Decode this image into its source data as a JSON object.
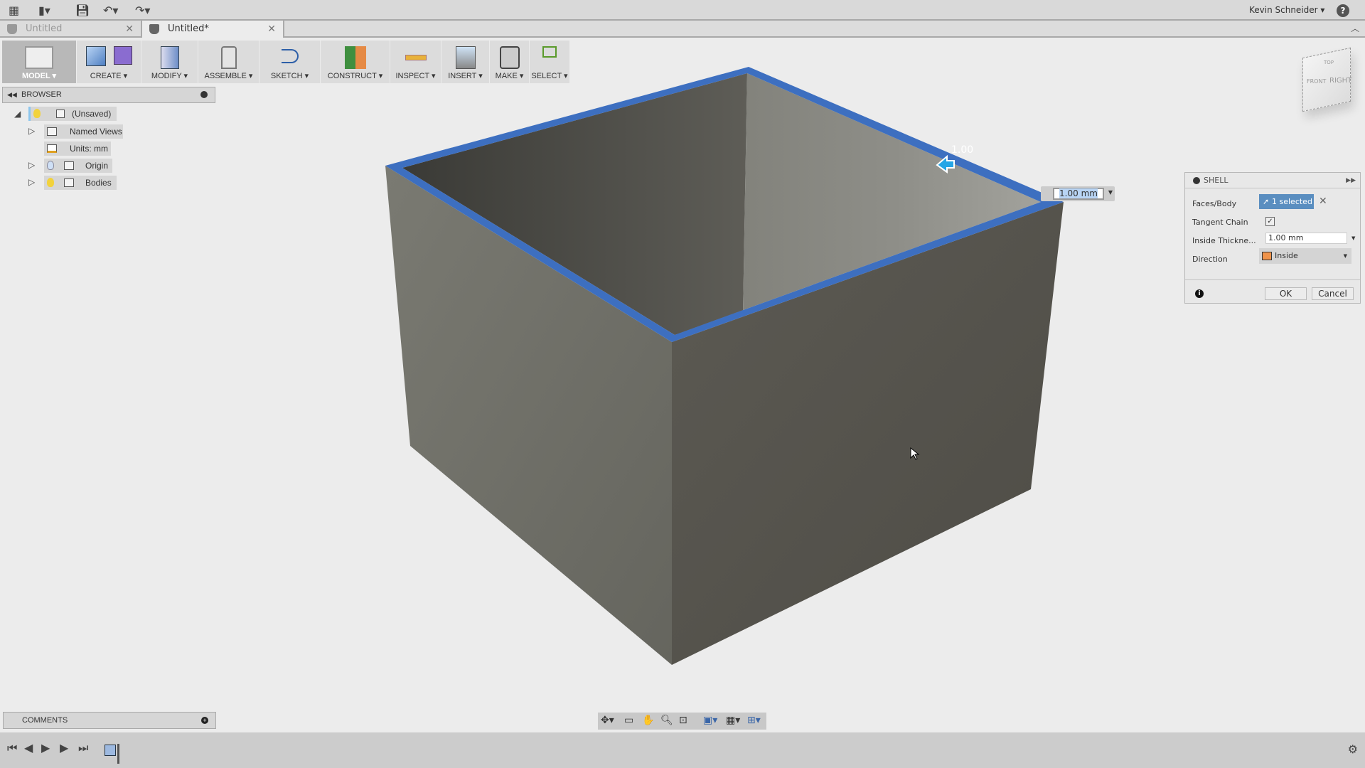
{
  "topbar": {
    "user": "Kevin Schneider ▾",
    "help": "?"
  },
  "tabs": [
    {
      "label": "Untitled",
      "active": false
    },
    {
      "label": "Untitled*",
      "active": true
    }
  ],
  "toolbar": {
    "groups": [
      "MODEL ▾",
      "CREATE ▾",
      "MODIFY ▾",
      "ASSEMBLE ▾",
      "SKETCH ▾",
      "CONSTRUCT ▾",
      "INSPECT ▾",
      "INSERT ▾",
      "MAKE ▾",
      "SELECT ▾"
    ]
  },
  "browser": {
    "title": "BROWSER",
    "items": [
      {
        "label": "(Unsaved)"
      },
      {
        "label": "Named Views"
      },
      {
        "label": "Units: mm"
      },
      {
        "label": "Origin"
      },
      {
        "label": "Bodies"
      }
    ]
  },
  "viewcube": {
    "top": "TOP",
    "front": "FRONT",
    "right": "RIGHT"
  },
  "viewport": {
    "manipulator_value": "1.00",
    "dimension_input": "1.00 mm"
  },
  "shell": {
    "title": "SHELL",
    "faces_label": "Faces/Body",
    "faces_value": "1 selected",
    "tangent_label": "Tangent Chain",
    "tangent_checked": true,
    "thickness_label": "Inside Thickne...",
    "thickness_value": "1.00 mm",
    "direction_label": "Direction",
    "direction_value": "Inside",
    "ok": "OK",
    "cancel": "Cancel"
  },
  "comments": {
    "title": "COMMENTS"
  },
  "colors": {
    "selection_blue": "#3d6fc0",
    "accent": "#5a8ec0"
  }
}
